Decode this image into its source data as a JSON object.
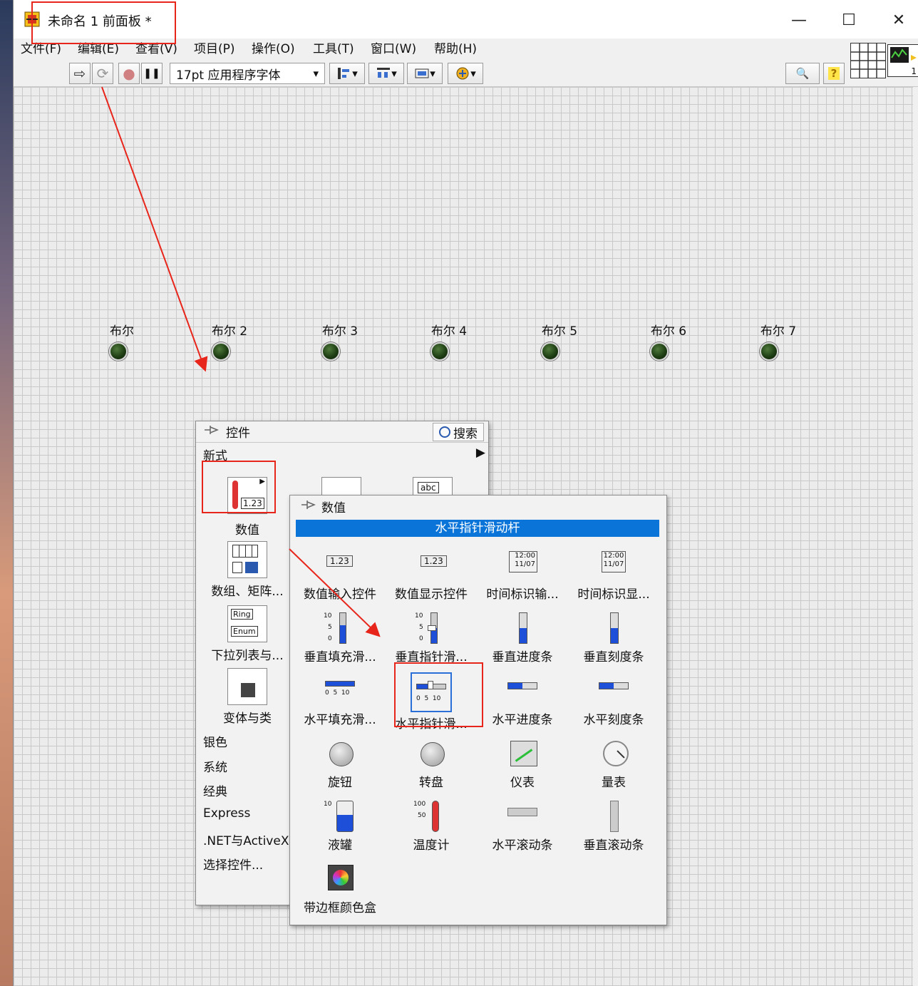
{
  "window": {
    "title": "未命名 1 前面板 *",
    "controls": {
      "minimize": "—",
      "maximize": "☐",
      "close": "✕"
    }
  },
  "menu": [
    "文件(F)",
    "编辑(E)",
    "查看(V)",
    "项目(P)",
    "操作(O)",
    "工具(T)",
    "窗口(W)",
    "帮助(H)"
  ],
  "toolbar": {
    "run": "⇨",
    "run_continuous": "⟳",
    "abort": "●",
    "pause": "❚❚",
    "font": "17pt 应用程序字体",
    "dropdown": "▾",
    "search": "🔍",
    "help": "?",
    "pane_index": "1"
  },
  "booleans": [
    "布尔",
    "布尔 2",
    "布尔 3",
    "布尔 4",
    "布尔 5",
    "布尔 6",
    "布尔 7"
  ],
  "controls_palette": {
    "title": "控件",
    "search": "搜索",
    "section": "新式",
    "categories": [
      "数值",
      "数组、矩阵...",
      "下拉列表与...",
      "变体与类"
    ],
    "other": [
      "银色",
      "系统",
      "经典",
      "Express",
      ".NET与ActiveX",
      "选择控件..."
    ]
  },
  "numeric_palette": {
    "title": "数值",
    "selected": "水平指针滑动杆",
    "items": [
      "数值输入控件",
      "数值显示控件",
      "时间标识输...",
      "时间标识显...",
      "垂直填充滑...",
      "垂直指针滑...",
      "垂直进度条",
      "垂直刻度条",
      "水平填充滑...",
      "水平指针滑...",
      "水平进度条",
      "水平刻度条",
      "旋钮",
      "转盘",
      "仪表",
      "量表",
      "液罐",
      "温度计",
      "水平滚动条",
      "垂直滚动条",
      "带边框颜色盒"
    ]
  },
  "icon_text": {
    "num": "1.23",
    "time": "12:00",
    "date": "11/07",
    "abc": "abc",
    "ring": "Ring",
    "enum": "Enum",
    "tick10": "10",
    "tick5": "5",
    "tick0": "0",
    "tick100": "100",
    "tick50": "50",
    "ticks_h": "0  5  10"
  }
}
